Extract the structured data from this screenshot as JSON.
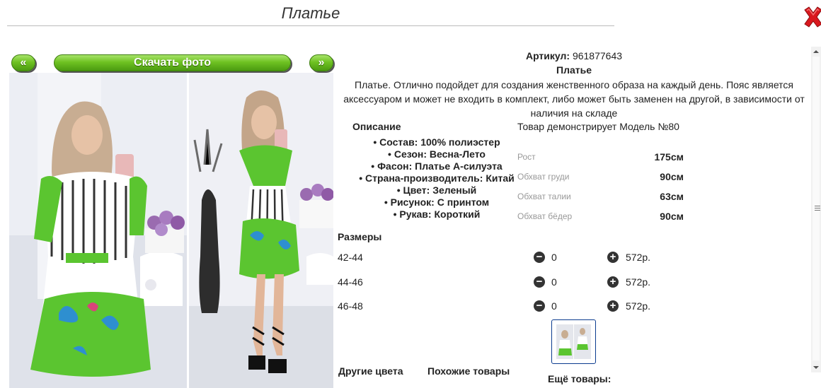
{
  "dialog": {
    "title": "Платье",
    "close_icon": "close-x-icon"
  },
  "gallery": {
    "prev_label": "«",
    "download_label": "Скачать фото",
    "next_label": "»"
  },
  "product": {
    "article_label": "Артикул:",
    "article_value": "961877643",
    "name": "Платье",
    "description": "Платье. Отлично подойдет для создания женственного образа на каждый день. Пояс является аксессуаром и может не входить в комплект, либо может быть заменен на другой, в зависимости от наличия на складе"
  },
  "description_section": {
    "heading": "Описание",
    "specs": [
      "Состав: 100% полиэстер",
      "Сезон: Весна-Лето",
      "Фасон: Платье А-силуэта",
      "Страна-производитель: Китай",
      "Цвет: Зеленый",
      "Рисунок: С принтом",
      "Рукав: Короткий"
    ]
  },
  "model": {
    "title": "Товар демонстрирует Модель №80",
    "measurements": [
      {
        "label": "Рост",
        "value": "175см"
      },
      {
        "label": "Обхват груди",
        "value": "90см"
      },
      {
        "label": "Обхват талии",
        "value": "63см"
      },
      {
        "label": "Обхват бёдер",
        "value": "90см"
      }
    ]
  },
  "sizes": {
    "heading": "Размеры",
    "rows": [
      {
        "size": "42-44",
        "qty": "0",
        "price": "572р."
      },
      {
        "size": "44-46",
        "qty": "0",
        "price": "572р."
      },
      {
        "size": "46-48",
        "qty": "0",
        "price": "572р."
      }
    ]
  },
  "footer": {
    "other_colors": "Другие цвета",
    "similar": "Похожие товары",
    "more_products": "Ещё товары:"
  },
  "colors": {
    "accent_green": "#6fc222",
    "close_red": "#d9181e",
    "thumb_border": "#0b3b8f"
  }
}
